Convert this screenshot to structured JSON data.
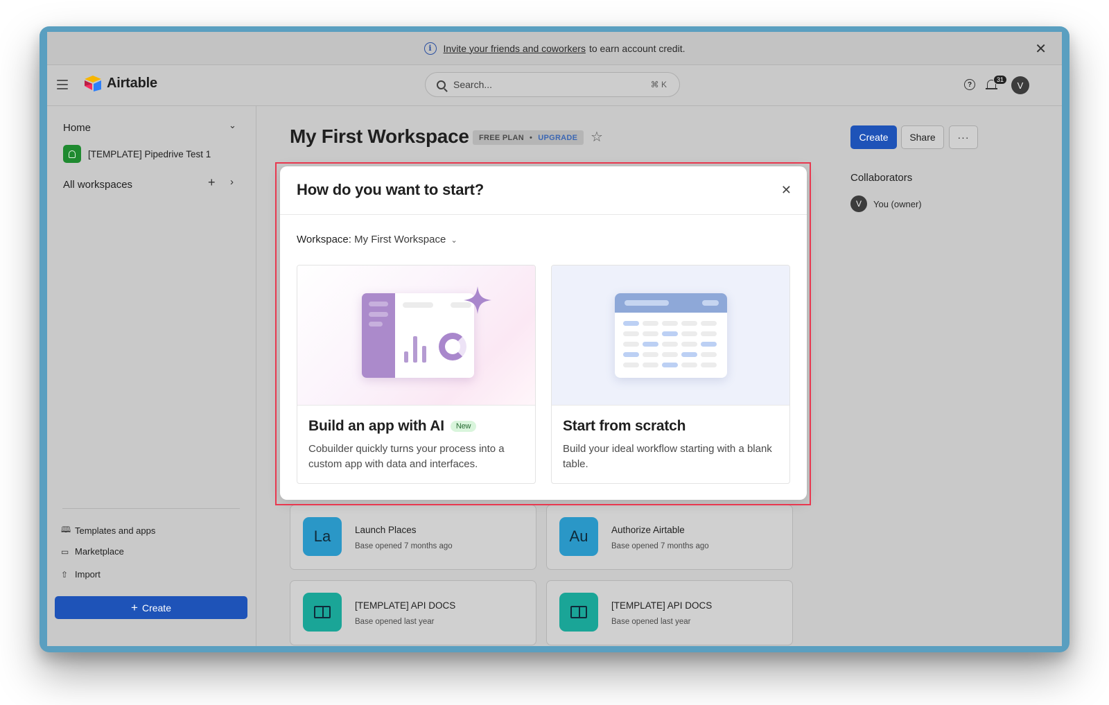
{
  "banner": {
    "link_text": "Invite your friends and coworkers",
    "rest_text": "to earn account credit."
  },
  "topbar": {
    "app_name": "Airtable",
    "search_placeholder": "Search...",
    "search_shortcut": "⌘ K",
    "notifications_count": "31",
    "user_initial": "V"
  },
  "sidebar": {
    "home_label": "Home",
    "recent_workspace": "[TEMPLATE] Pipedrive Test 1",
    "all_workspaces_label": "All workspaces",
    "links": [
      {
        "label": "Templates and apps",
        "icon": "book-icon"
      },
      {
        "label": "Marketplace",
        "icon": "marketplace-icon"
      },
      {
        "label": "Import",
        "icon": "upload-icon"
      }
    ],
    "create_label": "Create"
  },
  "workspace": {
    "title": "My First Workspace",
    "plan_label": "FREE PLAN",
    "upgrade_label": "UPGRADE",
    "create_button": "Create",
    "share_button": "Share",
    "more_button": "···",
    "collaborators_title": "Collaborators",
    "collaborators": [
      {
        "initial": "V",
        "name": "You (owner)"
      }
    ]
  },
  "bases": [
    {
      "abbr": "La",
      "name": "Launch Places",
      "opened": "Base opened 7 months ago",
      "color": "#2a97c7"
    },
    {
      "abbr": "Au",
      "name": "Authorize Airtable",
      "opened": "Base opened 7 months ago",
      "color": "#2a97c7"
    },
    {
      "abbr": "",
      "name": "[TEMPLATE] API DOCS",
      "opened": "Base opened last year",
      "color": "#1aa597",
      "icon": "book-icon"
    },
    {
      "abbr": "",
      "name": "[TEMPLATE] API DOCS",
      "opened": "Base opened last year",
      "color": "#1aa597",
      "icon": "book-icon"
    }
  ],
  "modal": {
    "title": "How do you want to start?",
    "workspace_label": "Workspace:",
    "workspace_value": "My First Workspace",
    "options": [
      {
        "title": "Build an app with AI",
        "badge": "New",
        "description": "Cobuilder quickly turns your process into a custom app with data and interfaces."
      },
      {
        "title": "Start from scratch",
        "badge": "",
        "description": "Build your ideal workflow starting with a blank table."
      }
    ]
  },
  "colors": {
    "primary": "#1e53b8",
    "highlight": "#e8384f",
    "badge_bg": "#d9f5dc"
  }
}
